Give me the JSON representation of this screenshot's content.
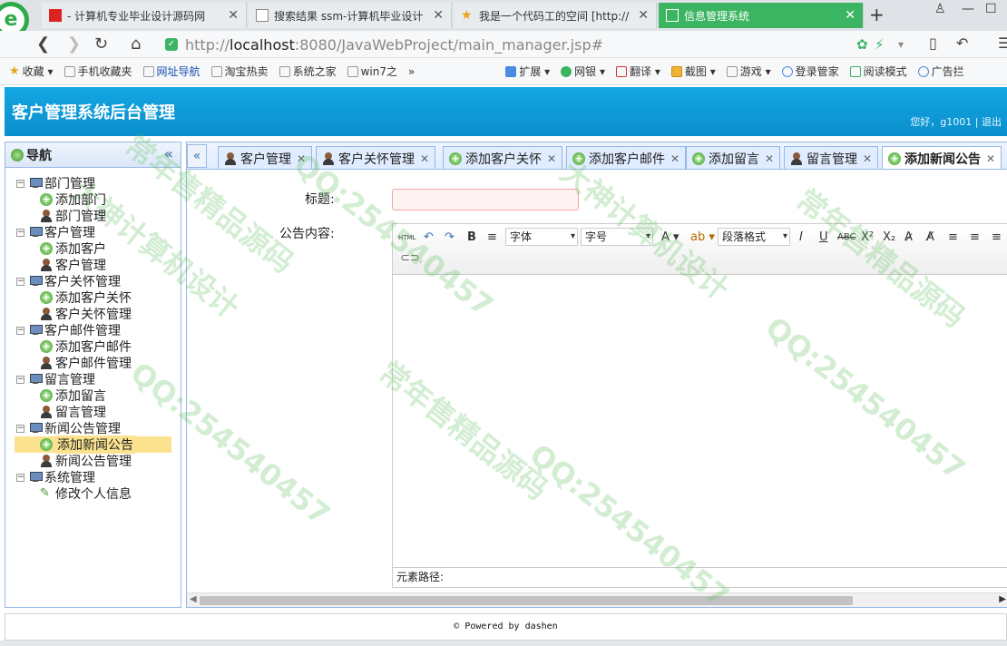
{
  "browser": {
    "tabs": [
      {
        "title": "- 计算机专业毕业设计源码网",
        "active": false
      },
      {
        "title": "搜索结果 ssm-计算机毕业设计",
        "active": false
      },
      {
        "title": "我是一个代码工的空间 [http://",
        "active": false
      },
      {
        "title": "信息管理系统",
        "active": true
      }
    ],
    "url_prefix": "http://",
    "url_host": "localhost",
    "url_rest": ":8080/JavaWebProject/main_manager.jsp#",
    "bookmarks": [
      "收藏",
      "手机收藏夹",
      "网址导航",
      "淘宝热卖",
      "系统之家",
      "win7之"
    ],
    "extensions": [
      "扩展",
      "网银",
      "翻译",
      "截图",
      "游戏",
      "登录管家",
      "阅读模式",
      "广告拦"
    ]
  },
  "app": {
    "title": "客户管理系统后台管理",
    "user_info": "您好，g1001 | 退出",
    "nav_title": "导航",
    "tree": [
      {
        "label": "部门管理",
        "children": [
          {
            "label": "添加部门",
            "icon": "plus"
          },
          {
            "label": "部门管理",
            "icon": "user"
          }
        ]
      },
      {
        "label": "客户管理",
        "children": [
          {
            "label": "添加客户",
            "icon": "plus"
          },
          {
            "label": "客户管理",
            "icon": "user"
          }
        ]
      },
      {
        "label": "客户关怀管理",
        "children": [
          {
            "label": "添加客户关怀",
            "icon": "plus"
          },
          {
            "label": "客户关怀管理",
            "icon": "user"
          }
        ]
      },
      {
        "label": "客户邮件管理",
        "children": [
          {
            "label": "添加客户邮件",
            "icon": "plus"
          },
          {
            "label": "客户邮件管理",
            "icon": "user"
          }
        ]
      },
      {
        "label": "留言管理",
        "children": [
          {
            "label": "添加留言",
            "icon": "plus"
          },
          {
            "label": "留言管理",
            "icon": "user"
          }
        ]
      },
      {
        "label": "新闻公告管理",
        "children": [
          {
            "label": "添加新闻公告",
            "icon": "plus",
            "selected": true
          },
          {
            "label": "新闻公告管理",
            "icon": "user"
          }
        ]
      },
      {
        "label": "系统管理",
        "children": [
          {
            "label": "修改个人信息",
            "icon": "pen"
          }
        ]
      }
    ],
    "tabs": [
      {
        "label": "客户管理",
        "icon": "user"
      },
      {
        "label": "客户关怀管理",
        "icon": "user"
      },
      {
        "label": "添加客户关怀",
        "icon": "plus"
      },
      {
        "label": "添加客户邮件",
        "icon": "plus"
      },
      {
        "label": "添加留言",
        "icon": "plus"
      },
      {
        "label": "留言管理",
        "icon": "user"
      },
      {
        "label": "添加新闻公告",
        "icon": "plus",
        "active": true
      }
    ],
    "form": {
      "title_label": "标题:",
      "content_label": "公告内容:",
      "editor": {
        "font_family": "字体",
        "font_size": "字号",
        "paragraph": "段落格式",
        "status": "元素路径:"
      }
    },
    "footer": "© Powered by dashen"
  },
  "watermarks": [
    "大神计算机设计",
    "QQ:254540457",
    "常年售精品源码"
  ]
}
